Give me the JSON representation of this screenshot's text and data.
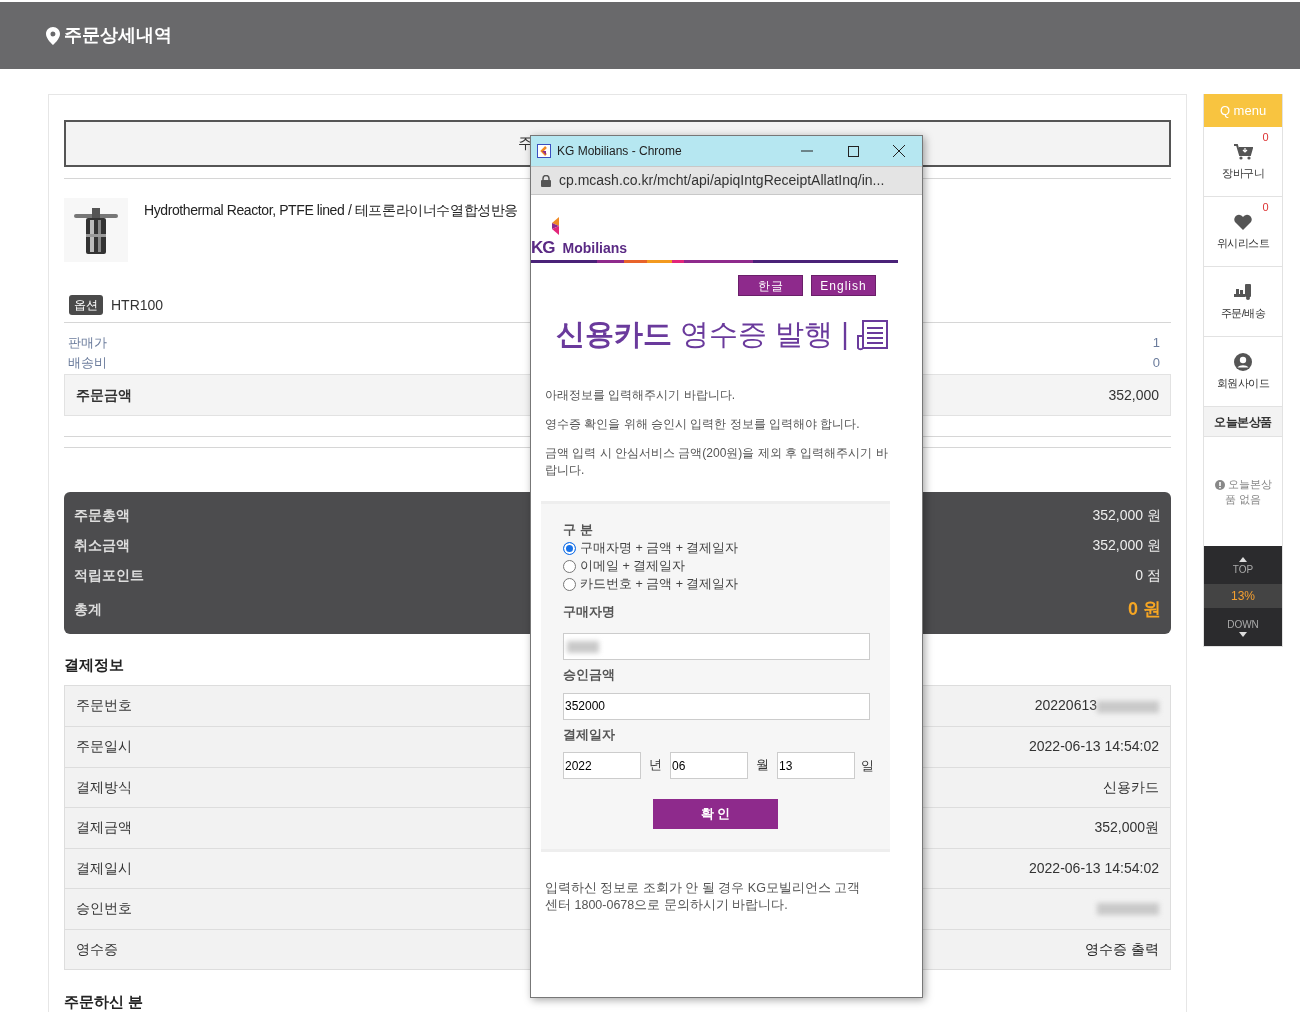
{
  "header": {
    "title": "주문상세내역"
  },
  "order_box": {
    "title": "주"
  },
  "product": {
    "name": "Hydrothermal Reactor, PTFE lined / 테프론라이너수열합성반응",
    "option_badge": "옵션",
    "option_value": "HTR100"
  },
  "price_lines": [
    {
      "label": "판매가",
      "value": "1"
    },
    {
      "label": "배송비",
      "value": "0"
    }
  ],
  "order_amount": {
    "label": "주문금액",
    "value": "352,000"
  },
  "summary": [
    {
      "label": "주문총액",
      "value": "352,000 원",
      "kind": "normal"
    },
    {
      "label": "취소금액",
      "value": "352,000 원",
      "kind": "normal"
    },
    {
      "label": "적립포인트",
      "value": "0 점",
      "kind": "normal"
    },
    {
      "label": "총계",
      "value": "0 원",
      "kind": "total"
    }
  ],
  "payment_info": {
    "heading": "결제정보",
    "rows": [
      {
        "label": "주문번호",
        "value": "20220613",
        "redacted": true,
        "kind": "text"
      },
      {
        "label": "주문일시",
        "value": "2022-06-13 14:54:02",
        "redacted": false,
        "kind": "text"
      },
      {
        "label": "결제방식",
        "value": "신용카드",
        "redacted": false,
        "kind": "text"
      },
      {
        "label": "결제금액",
        "value": "352,000원",
        "redacted": false,
        "kind": "text"
      },
      {
        "label": "결제일시",
        "value": "2022-06-13 14:54:02",
        "redacted": false,
        "kind": "text"
      },
      {
        "label": "승인번호",
        "redacted": true,
        "kind": "text"
      },
      {
        "label": "영수증",
        "value": "영수증 출력",
        "redacted": false,
        "kind": "link"
      }
    ]
  },
  "orderer": {
    "heading": "주문하신 분"
  },
  "quick_menu": {
    "title": "Q menu",
    "items": [
      {
        "label": "장바구니",
        "kind": "cart",
        "count": "0"
      },
      {
        "label": "위시리스트",
        "kind": "heart",
        "count": "0"
      },
      {
        "label": "주문/배송",
        "kind": "truck"
      },
      {
        "label": "회원사이드",
        "kind": "user"
      }
    ],
    "recent": {
      "title": "오늘본상품",
      "empty": "오늘본상품 없음"
    },
    "scroll": {
      "top": "TOP",
      "percent": "13%",
      "down": "DOWN"
    }
  },
  "popup": {
    "title": "KG Mobilians - Chrome",
    "url": "cp.mcash.co.kr/mcht/api/apiqIntgReceiptAllatInq/in...",
    "logo_mark": "KG",
    "logo_name": "Mobilians",
    "languages": [
      {
        "label": "한글"
      },
      {
        "label": "English"
      }
    ],
    "heading": "**신용카드** 영수증 발행 |",
    "notes": [
      "아래정보를 입력해주시기 바랍니다.",
      "영수증 확인을 위해 승인시 입력한 정보를 입력해야 합니다.",
      "금액 입력 시 안심서비스 금액(200원)을 제외 후 입력해주시기 바랍니다."
    ],
    "form": {
      "type_label": "구 분",
      "options": [
        {
          "label": "구매자명 + 금액 + 결제일자",
          "selected": true
        },
        {
          "label": "이메일 + 결제일자",
          "selected": false
        },
        {
          "label": "카드번호 + 금액 + 결제일자",
          "selected": false
        }
      ],
      "name_label": "구매자명",
      "name_redacted": true,
      "amount_label": "승인금액",
      "amount_value": "352000",
      "date_label": "결제일자",
      "date_parts": [
        {
          "value": "2022",
          "unit": "년"
        },
        {
          "value": "06",
          "unit": "월"
        },
        {
          "value": "13",
          "unit": "일"
        }
      ],
      "submit": "확 인"
    },
    "footer_note": "입력하신 정보로 조회가 안 될 경우 KG모빌리언스 고객센터 1800-0678으로 문의하시기 바랍니다."
  }
}
